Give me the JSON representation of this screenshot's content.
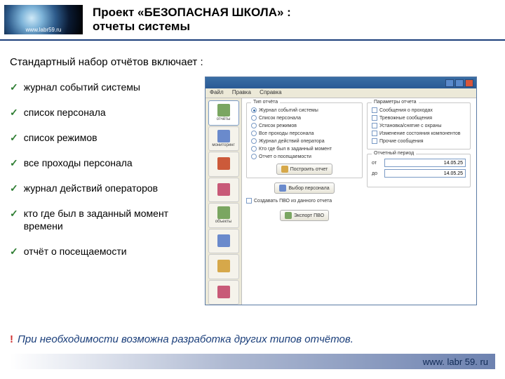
{
  "header": {
    "logo_text": "www.labr59.ru",
    "title_line1": "Проект «БЕЗОПАСНАЯ ШКОЛА» :",
    "title_line2": "отчеты системы"
  },
  "intro": "Стандартный набор отчётов включает :",
  "checklist": [
    "журнал событий системы",
    "список персонала",
    "список режимов",
    "все проходы персонала",
    "журнал действий операторов",
    "кто где был в заданный момент времени",
    "отчёт о посещаемости"
  ],
  "screenshot": {
    "window_title": "",
    "menus": [
      "Файл",
      "Правка",
      "Справка"
    ],
    "sidebar": [
      {
        "label": "отчёты",
        "icon_color": "#7aa661"
      },
      {
        "label": "мониторинг",
        "icon_color": "#6a8acc"
      },
      {
        "label": "",
        "icon_color": "#cc5a3a"
      },
      {
        "label": "",
        "icon_color": "#c85a78"
      },
      {
        "label": "объекты",
        "icon_color": "#7aa661"
      },
      {
        "label": "",
        "icon_color": "#6a8acc"
      },
      {
        "label": "",
        "icon_color": "#d6a84a"
      },
      {
        "label": "",
        "icon_color": "#c85a78"
      }
    ],
    "panel_left": {
      "title": "Тип отчёта",
      "options": [
        {
          "label": "Журнал событий системы",
          "selected": true
        },
        {
          "label": "Список персонала",
          "selected": false
        },
        {
          "label": "Список режимов",
          "selected": false
        },
        {
          "label": "Все проходы персонала",
          "selected": false
        },
        {
          "label": "Журнал действий оператора",
          "selected": false
        },
        {
          "label": "Кто где был в заданный момент",
          "selected": false
        },
        {
          "label": "Отчет о посещаемости",
          "selected": false
        }
      ],
      "build_btn": "Построить отчет",
      "select_btn": "Выбор персонала",
      "export_cb": "Создавать ПВО из данного отчета",
      "export_btn": "Экспорт ПВО"
    },
    "panel_right": {
      "title": "Параметры отчета",
      "opts": [
        {
          "label": "Сообщения о проходах",
          "checked": false
        },
        {
          "label": "Тревожные сообщения",
          "checked": false
        },
        {
          "label": "Установка/снятие с охраны",
          "checked": false
        },
        {
          "label": "Изменение состояния компонентов",
          "checked": false
        },
        {
          "label": "Прочие сообщения",
          "checked": false
        }
      ],
      "period_title": "Отчетный период",
      "from_label": "от",
      "to_label": "до",
      "from_value": "14.05.25",
      "to_value": "14.05.25"
    }
  },
  "footer_note": "При необходимости возможна разработка других типов отчётов.",
  "footer_url": "www. labr 59. ru"
}
